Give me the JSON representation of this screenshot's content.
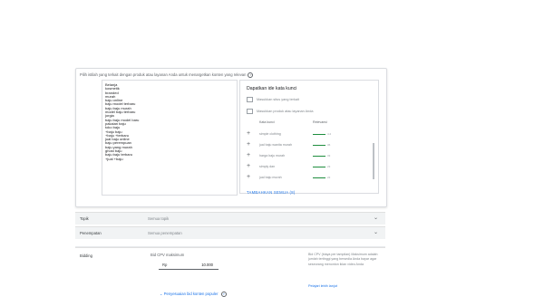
{
  "instruction": "Pilih istilah yang terkait dengan produk atau layanan Anda untuk menargetkan konten yang relevan",
  "keywords": [
    "Belanja",
    "kosmetik",
    "branded",
    "murah",
    "baju online",
    "baju model terbaru",
    "baju baju murah",
    "model baju terbaru",
    "jorgia",
    "baju baju model baru",
    "pakaian baju",
    "toko baju",
    "+baju baju",
    "+baju +terbaru",
    "jual baju online",
    "baju perempuan",
    "baju yang murah",
    "ghost baju",
    "baju baju terbaru",
    "+jual +baju"
  ],
  "ideas": {
    "title": "Dapatkan ide kata kunci",
    "option_site": "Masukkan situs yang terkait",
    "option_product": "Masukkan produk atau layanan Anda",
    "col_keyword": "Kata kunci",
    "col_relevance": "Relevansi",
    "rows": [
      {
        "keyword": "simple clothing",
        "relevance": "4.2",
        "rel_level": 1.0
      },
      {
        "keyword": "jual baju wanita murah",
        "relevance": "36",
        "rel_level": 1.0
      },
      {
        "keyword": "harga baju murah",
        "relevance": "33",
        "rel_level": 1.0
      },
      {
        "keyword": "simply dan",
        "relevance": "23",
        "rel_level": 1.0
      },
      {
        "keyword": "jual baju murah",
        "relevance": "22",
        "rel_level": 1.0
      }
    ],
    "add_all": "TAMBAHKAN SEMUA (8)"
  },
  "sections": [
    {
      "label": "Topik",
      "value": "Semua topik"
    },
    {
      "label": "Penempatan",
      "value": "Semua penempatan"
    }
  ],
  "bidding": {
    "label": "Bidding",
    "max_label": "Bid CPV maksimum",
    "currency": "Rp",
    "value": "10.000",
    "info": "Bid CPV (biaya per tampilan) Maksimum adalah jumlah tertinggi yang bersedia Anda bayar agar seseorang menonton iklan video Anda",
    "learn_more": "Pelajari lebih lanjut",
    "adjust": "Penyesuaian bid konten populer"
  },
  "colors": {
    "accent": "#1a73e8",
    "relevance_bar": "#1e8e3e"
  }
}
